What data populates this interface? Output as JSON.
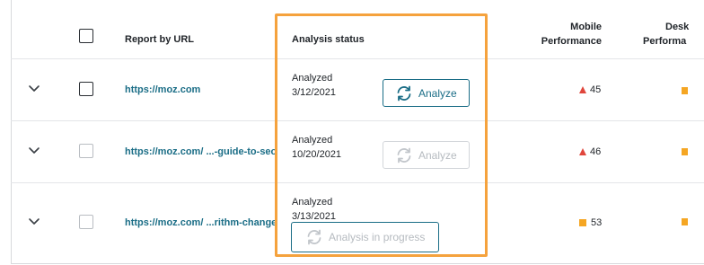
{
  "header": {
    "report_by_url": "Report by URL",
    "analysis_status": "Analysis status",
    "mobile_performance_line1": "Mobile",
    "mobile_performance_line2": "Performance",
    "desktop_performance_line1": "Desk",
    "desktop_performance_line2": "Performa"
  },
  "rows": [
    {
      "url": "https://moz.com",
      "status_label": "Analyzed",
      "status_date": "3/12/2021",
      "button_label": "Analyze",
      "button_state": "active",
      "mobile_score": "45",
      "mobile_indicator": "red-triangle-icon"
    },
    {
      "url": "https://moz.com/ ...-guide-to-seo",
      "status_label": "Analyzed",
      "status_date": "10/20/2021",
      "button_label": "Analyze",
      "button_state": "disabled",
      "mobile_score": "46",
      "mobile_indicator": "red-triangle-icon"
    },
    {
      "url": "https://moz.com/ ...rithm-change",
      "status_label": "Analyzed",
      "status_date": "3/13/2021",
      "button_label": "Analysis in progress",
      "button_state": "in-progress",
      "mobile_score": "53",
      "mobile_indicator": "orange-square-icon"
    }
  ],
  "colors": {
    "link": "#1a6d86",
    "highlight": "#f5a23d",
    "red_indicator": "#e0463c",
    "orange_indicator": "#f5a623"
  }
}
